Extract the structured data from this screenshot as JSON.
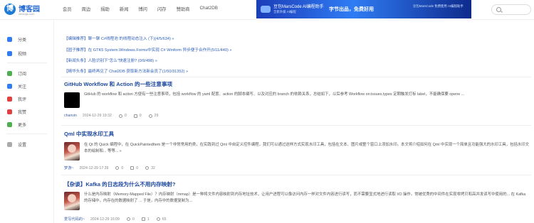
{
  "header": {
    "logo_title": "博客园",
    "logo_subtitle": "cnblogs.com",
    "nav": [
      "会员",
      "周边",
      "捐助",
      "新闻",
      "博问",
      "闪存",
      "赞助商",
      "Chat2DB"
    ],
    "promo": {
      "tag": "豆包MarsCode AI编程助手",
      "subtext": "全新升级 AI编程",
      "headline": "字节出品，免费好用",
      "right": "豆包MarsCode 免费使用 AI编程助手"
    },
    "search_placeholder": ""
  },
  "sidebar": {
    "items": [
      {
        "label": "分类",
        "icon": "category-icon",
        "color": "#2f7cf4"
      },
      {
        "label": "视频",
        "icon": "video-icon",
        "color": "#2f7cf4"
      },
      {
        "label": "订阅",
        "icon": "subscribe-icon",
        "color": "#4caf50"
      },
      {
        "label": "关注",
        "icon": "follow-icon",
        "color": "#2f7cf4"
      },
      {
        "label": "我评",
        "icon": "comment-icon",
        "color": "#e04040"
      },
      {
        "label": "我赞",
        "icon": "like-icon",
        "color": "#e04040"
      },
      {
        "label": "更多",
        "icon": "more-icon",
        "color": "#4caf50"
      },
      {
        "label": "设置",
        "icon": "settings-icon",
        "color": "#aaaaaa"
      }
    ]
  },
  "pinned": [
    {
      "tag": "【编辑推荐】",
      "text": "聊一聊 C#线程池 的线程动态注入 (下)(4/5/634) »"
    },
    {
      "tag": "【园子推荐】",
      "text": "在 GTK5 System.Windows.Forms中实现 C# Winform 异步便于合作开(5/11/440) »"
    },
    {
      "tag": "【新闻头条】",
      "text": "人脸识别下\"怎么\"快速注册? (0/9/498) »"
    },
    {
      "tag": "【精华头条】",
      "text": "最终再见了 Chat2DB 获取新方法新会员了(1/50/31352) »"
    }
  ],
  "articles": [
    {
      "title": "GitHub Workflow 和 Action 的一些注意事项",
      "excerpt": "GitHub 的 workflow 和 action 方便有一些注意事项，包括 workflow 的 yaml 配置、action 的脚本编写、以及对应的 branch 的依赖关系，总结如下，以后参考 Workflow on:issues.types 定期触发打标 label，不能确保要 opene ...",
      "author": "chanvin",
      "date": "2024-12-29 19:32",
      "comments": "0",
      "likes": "0",
      "views": "29",
      "thumb": "black"
    },
    {
      "title": "Qml 中实现水印工具",
      "excerpt": "在 Qt 的 Quick 编程中，在 QuickPaintedItem 是一个非常常用的类，在实践到过 Qml 中自定义控件编程，我们可以通过这样方式实现水印工具，包括在文本、图片或整个窗口上添加水印。本文将介绍如何在 Qml 中实现一个简单且功能强大的水印工具，包括水印文本的绘制和... 等等... »",
      "author": "梦游~",
      "date": "2024-12-29 17:39",
      "comments": "0",
      "likes": "0",
      "views": "32",
      "thumb": "anime"
    },
    {
      "title": "【杂谈】Kafka 的日志段为什么不用内存映射?",
      "excerpt": "什么是内存映射（Memory-Mapped File）？内存映射（mmap）是一种将文件内容映射到内存地址技术，让用户进程可以像访问内存一样对文件内容进行读写，而不需要显式地进行读取 I/O 操作。常被优秀的中间件在实现零拷贝和高并发读写中使用的... 在 Kafka 的存储中，内存在的数据映射了 ... 于是，内存中的数据复制为...",
      "author": "爱写代码的~",
      "date": "2024-12-29 16:09",
      "comments": "0",
      "likes": "1",
      "views": "65",
      "thumb": "anime"
    }
  ]
}
